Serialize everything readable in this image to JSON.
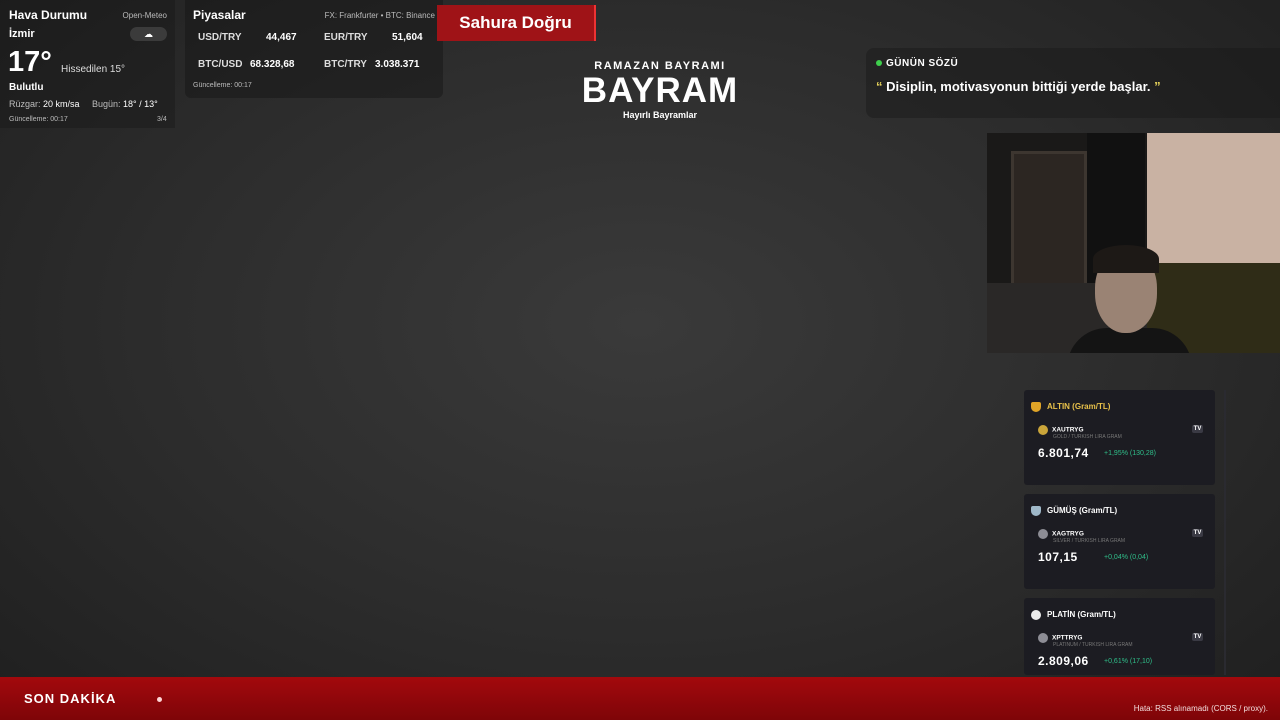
{
  "weather": {
    "title": "Hava Durumu",
    "source": "Open-Meteo",
    "city": "İzmir",
    "icon": "cloud-icon",
    "icon_glyph": "☁",
    "temp": "17°",
    "feels": "Hissedilen 15°",
    "condition": "Bulutlu",
    "wind_label": "Rüzgar:",
    "wind_value": "20 km/sa",
    "today_label": "Bugün:",
    "today_value": "18° / 13°",
    "updated": "Güncelleme: 00:17",
    "page": "3/4"
  },
  "markets": {
    "title": "Piyasalar",
    "source": "FX: Frankfurter • BTC: Binance",
    "rates": [
      {
        "label": "USD/TRY",
        "value": "44,467"
      },
      {
        "label": "EUR/TRY",
        "value": "51,604"
      },
      {
        "label": "BTC/USD",
        "value": "68.328,68"
      },
      {
        "label": "BTC/TRY",
        "value": "3.038.371"
      }
    ],
    "updated": "Güncelleme: 00:17"
  },
  "sahur": {
    "label": "Sahura Doğru"
  },
  "bayram": {
    "subtitle": "RAMAZAN BAYRAMI",
    "title": "BAYRAM",
    "caption": "Hayırlı Bayramlar"
  },
  "quote": {
    "header": "GÜNÜN SÖZÜ",
    "open_mark": "“",
    "text": "Disiplin, motivasyonun bittiği yerde başlar.",
    "close_mark": "”"
  },
  "metals": [
    {
      "name": "ALTIN (Gram/TL)",
      "icon": "gold-medal-icon",
      "color": "#e0a427",
      "name_color": "#e8c14a",
      "symbol": "XAUTRYG",
      "desc": "GOLD / TURKISH LIRA GRAM",
      "price": "6.801,74",
      "change": "+1,95% (130,28)"
    },
    {
      "name": "GÜMÜŞ (Gram/TL)",
      "icon": "silver-medal-icon",
      "color": "#9fb8c9",
      "name_color": "#ffffff",
      "symbol": "XAGTRYG",
      "desc": "SILVER / TURKISH LIRA GRAM",
      "price": "107,15",
      "change": "+0,04% (0,04)"
    },
    {
      "name": "PLATİN (Gram/TL)",
      "icon": "platinum-circle-icon",
      "color": "#ececec",
      "name_color": "#ffffff",
      "symbol": "XPTTRYG",
      "desc": "PLATINUM / TURKISH LIRA GRAM",
      "price": "2.809,06",
      "change": "+0,61% (17,10)"
    }
  ],
  "ticker": {
    "label": "SON DAKİKA",
    "error": "Hata: RSS alınamadı (CORS / proxy)."
  },
  "colors": {
    "accent_red": "#9f1317",
    "positive": "#2fbf8a",
    "quote_mark": "#e7d35a",
    "live_dot": "#3ecf4c"
  }
}
